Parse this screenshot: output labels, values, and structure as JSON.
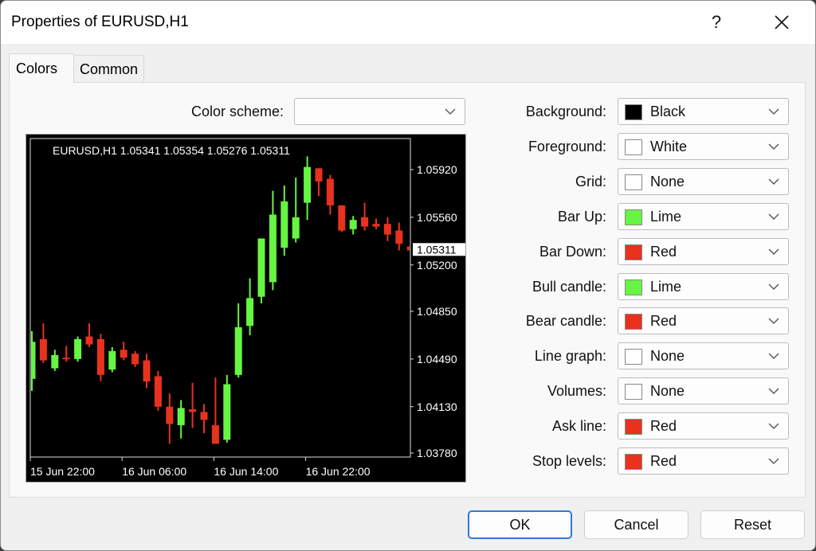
{
  "window": {
    "title": "Properties of EURUSD,H1",
    "help_label": "?",
    "close_label": "✕"
  },
  "tabs": [
    {
      "label": "Colors",
      "active": true
    },
    {
      "label": "Common",
      "active": false
    }
  ],
  "color_scheme": {
    "label": "Color scheme:",
    "value": ""
  },
  "color_settings": [
    {
      "label": "Background:",
      "value": "Black",
      "swatch": "#000000"
    },
    {
      "label": "Foreground:",
      "value": "White",
      "swatch": "#ffffff"
    },
    {
      "label": "Grid:",
      "value": "None",
      "swatch": "#ffffff"
    },
    {
      "label": "Bar Up:",
      "value": "Lime",
      "swatch": "#66f542"
    },
    {
      "label": "Bar Down:",
      "value": "Red",
      "swatch": "#e8321e"
    },
    {
      "label": "Bull candle:",
      "value": "Lime",
      "swatch": "#66f542"
    },
    {
      "label": "Bear candle:",
      "value": "Red",
      "swatch": "#e8321e"
    },
    {
      "label": "Line graph:",
      "value": "None",
      "swatch": "#ffffff"
    },
    {
      "label": "Volumes:",
      "value": "None",
      "swatch": "#ffffff"
    },
    {
      "label": "Ask line:",
      "value": "Red",
      "swatch": "#e8321e"
    },
    {
      "label": "Stop levels:",
      "value": "Red",
      "swatch": "#e8321e"
    }
  ],
  "buttons": {
    "ok": "OK",
    "cancel": "Cancel",
    "reset": "Reset"
  },
  "chart_data": {
    "type": "candlestick",
    "title": "EURUSD,H1  1.05341 1.05354 1.05276 1.05311",
    "symbol": "EURUSD,H1",
    "ohlc_header": [
      "1.05341",
      "1.05354",
      "1.05276",
      "1.05311"
    ],
    "current_price_label": "1.05311",
    "current_price": 1.05311,
    "ylim": [
      1.0365,
      1.0615
    ],
    "y_ticks": [
      "1.05920",
      "1.05560",
      "1.05200",
      "1.04850",
      "1.04490",
      "1.04130",
      "1.03780"
    ],
    "y_tick_values": [
      1.0592,
      1.0556,
      1.052,
      1.0485,
      1.0449,
      1.0413,
      1.0378
    ],
    "x_ticks": [
      {
        "label": "15 Jun 22:00",
        "index": 0
      },
      {
        "label": "16 Jun 06:00",
        "index": 8
      },
      {
        "label": "16 Jun 14:00",
        "index": 16
      },
      {
        "label": "16 Jun 22:00",
        "index": 24
      }
    ],
    "grid": false,
    "bull_color": "#66f542",
    "bear_color": "#e8321e",
    "background": "#000000",
    "foreground": "#ffffff",
    "candles": [
      {
        "o": 1.0434,
        "h": 1.047,
        "l": 1.0425,
        "c": 1.0462
      },
      {
        "o": 1.0464,
        "h": 1.0476,
        "l": 1.0446,
        "c": 1.0448
      },
      {
        "o": 1.0442,
        "h": 1.0456,
        "l": 1.044,
        "c": 1.0452
      },
      {
        "o": 1.045,
        "h": 1.0459,
        "l": 1.0447,
        "c": 1.0449
      },
      {
        "o": 1.0449,
        "h": 1.0466,
        "l": 1.0447,
        "c": 1.0464
      },
      {
        "o": 1.0466,
        "h": 1.0476,
        "l": 1.0458,
        "c": 1.046
      },
      {
        "o": 1.0464,
        "h": 1.0468,
        "l": 1.0432,
        "c": 1.0437
      },
      {
        "o": 1.0441,
        "h": 1.0458,
        "l": 1.0439,
        "c": 1.0455
      },
      {
        "o": 1.0456,
        "h": 1.0462,
        "l": 1.0448,
        "c": 1.045
      },
      {
        "o": 1.0453,
        "h": 1.0455,
        "l": 1.0443,
        "c": 1.0445
      },
      {
        "o": 1.0448,
        "h": 1.0453,
        "l": 1.0427,
        "c": 1.0432
      },
      {
        "o": 1.0436,
        "h": 1.044,
        "l": 1.041,
        "c": 1.0413
      },
      {
        "o": 1.0413,
        "h": 1.0423,
        "l": 1.0385,
        "c": 1.04
      },
      {
        "o": 1.0399,
        "h": 1.0418,
        "l": 1.0389,
        "c": 1.0412
      },
      {
        "o": 1.0411,
        "h": 1.0431,
        "l": 1.0397,
        "c": 1.0409
      },
      {
        "o": 1.0409,
        "h": 1.0415,
        "l": 1.0393,
        "c": 1.0403
      },
      {
        "o": 1.0399,
        "h": 1.0435,
        "l": 1.0386,
        "c": 1.0385
      },
      {
        "o": 1.0388,
        "h": 1.0437,
        "l": 1.0386,
        "c": 1.043
      },
      {
        "o": 1.0437,
        "h": 1.0491,
        "l": 1.0435,
        "c": 1.0473
      },
      {
        "o": 1.0474,
        "h": 1.051,
        "l": 1.0467,
        "c": 1.0495
      },
      {
        "o": 1.0496,
        "h": 1.0531,
        "l": 1.0491,
        "c": 1.054
      },
      {
        "o": 1.0507,
        "h": 1.0576,
        "l": 1.0501,
        "c": 1.0558
      },
      {
        "o": 1.0533,
        "h": 1.058,
        "l": 1.0527,
        "c": 1.0568
      },
      {
        "o": 1.054,
        "h": 1.0586,
        "l": 1.0537,
        "c": 1.0556
      },
      {
        "o": 1.0567,
        "h": 1.0602,
        "l": 1.0554,
        "c": 1.0594
      },
      {
        "o": 1.0593,
        "h": 1.0593,
        "l": 1.0572,
        "c": 1.0583
      },
      {
        "o": 1.0585,
        "h": 1.0588,
        "l": 1.0558,
        "c": 1.0565
      },
      {
        "o": 1.0565,
        "h": 1.0565,
        "l": 1.0545,
        "c": 1.0546
      },
      {
        "o": 1.0547,
        "h": 1.0557,
        "l": 1.0543,
        "c": 1.0554
      },
      {
        "o": 1.0556,
        "h": 1.0567,
        "l": 1.0546,
        "c": 1.0549
      },
      {
        "o": 1.0551,
        "h": 1.0555,
        "l": 1.0547,
        "c": 1.0549
      },
      {
        "o": 1.0551,
        "h": 1.0556,
        "l": 1.0538,
        "c": 1.0543
      },
      {
        "o": 1.0546,
        "h": 1.0552,
        "l": 1.0531,
        "c": 1.0536
      },
      {
        "o": 1.0534,
        "h": 1.0535,
        "l": 1.0528,
        "c": 1.0531
      }
    ]
  }
}
